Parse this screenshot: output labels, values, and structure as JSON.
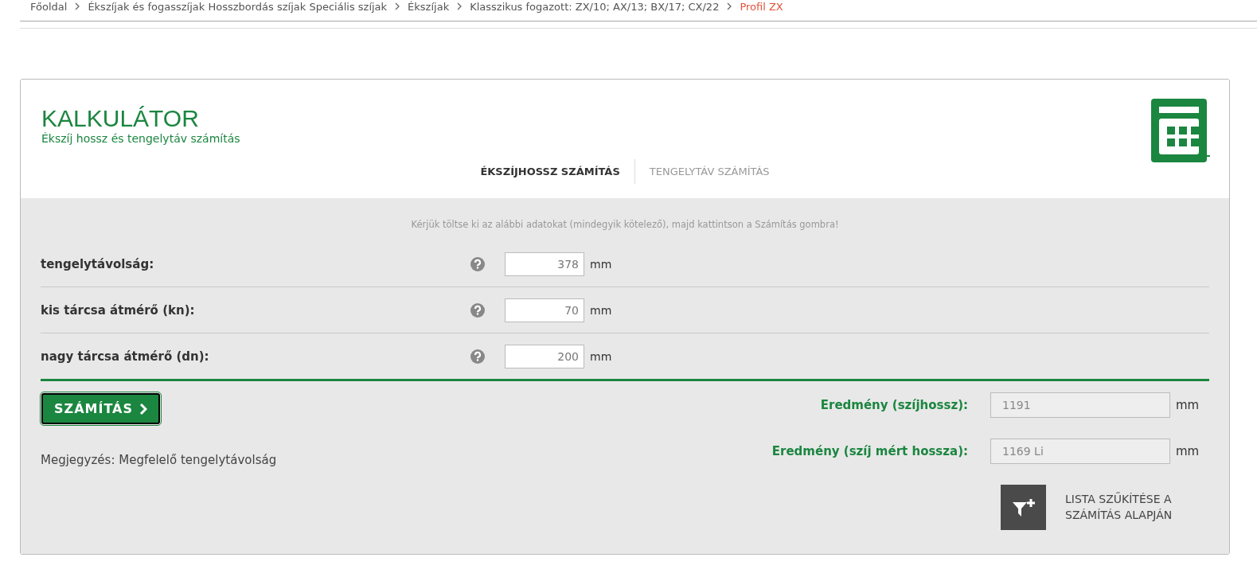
{
  "breadcrumb": [
    {
      "label": "Főoldal",
      "current": false
    },
    {
      "label": "Ékszíjak és fogasszíjak Hosszbordás szíjak Speciális szíjak",
      "current": false
    },
    {
      "label": "Ékszíjak",
      "current": false
    },
    {
      "label": "Klasszikus fogazott: ZX/10; AX/13; BX/17; CX/22",
      "current": false
    },
    {
      "label": "Profil ZX",
      "current": true
    }
  ],
  "calculator": {
    "title": "KALKULÁTOR",
    "subtitle": "Ékszíj hossz és tengelytáv számítás",
    "tabs": [
      {
        "label": "ÉKSZÍJHOSSZ SZÁMÍTÁS",
        "selected": true
      },
      {
        "label": "TENGELYTÁV SZÁMÍTÁS",
        "selected": false
      }
    ],
    "instruction": "Kérjük töltse ki az alábbi adatokat (mindegyik kötelező), majd kattintson a Számítás gombra!",
    "fields": [
      {
        "label": "tengelytávolság:",
        "value": "378",
        "unit": "mm"
      },
      {
        "label": "kis tárcsa átmérő (kn):",
        "value": "70",
        "unit": "mm"
      },
      {
        "label": "nagy tárcsa átmérő (dn):",
        "value": "200",
        "unit": "mm"
      }
    ],
    "button": "SZÁMÍTÁS",
    "note": "Megjegyzés: Megfelelő tengelytávolság",
    "results": [
      {
        "label": "Eredmény (szíjhossz):",
        "value": "1191",
        "unit": "mm"
      },
      {
        "label": "Eredmény (szíj mért hossza):",
        "value": "1169 Li",
        "unit": "mm"
      }
    ],
    "filter_action": [
      "LISTA SZŰKÍTÉSE A",
      "SZÁMÍTÁS ALAPJÁN"
    ]
  }
}
